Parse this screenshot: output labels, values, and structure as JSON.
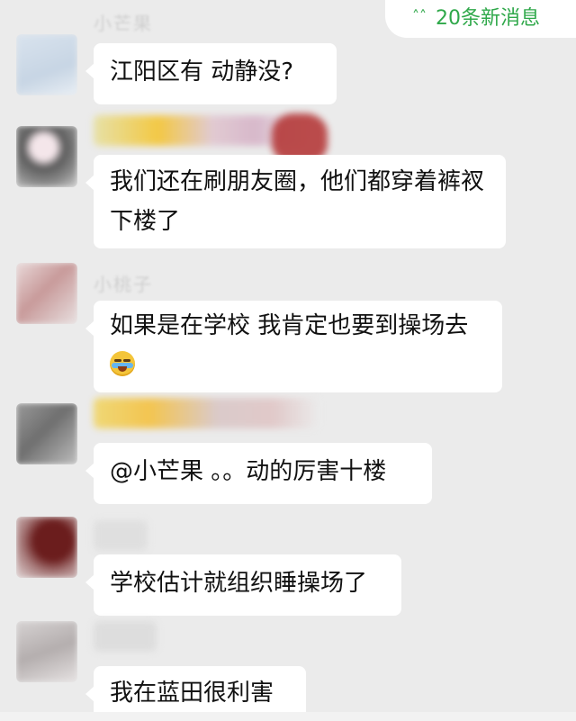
{
  "header": {
    "unread_chevron": "double-chevron-up-icon",
    "unread_label": "20条新消息",
    "accent_color": "#2fa84a"
  },
  "messages": [
    {
      "sender": "小芒果",
      "text": "江阳区有  动静没?"
    },
    {
      "sender": "",
      "text": "我们还在刷朋友圈，他们都穿着裤衩下楼了"
    },
    {
      "sender": "小桃子",
      "text": "如果是在学校 我肯定也要到操场去",
      "emoji": "crying-laughing-emoji-icon"
    },
    {
      "sender": "",
      "text": "@小芒果 。。动的厉害十楼"
    },
    {
      "sender": "",
      "text": "学校估计就组织睡操场了"
    },
    {
      "sender": "",
      "text": "我在蓝田很利害"
    }
  ],
  "colors": {
    "background": "#ebebeb",
    "bubble": "#ffffff",
    "text": "#111111"
  }
}
